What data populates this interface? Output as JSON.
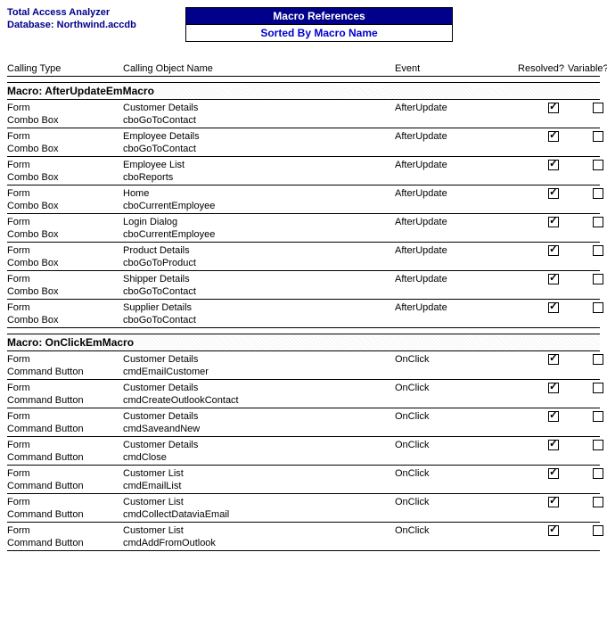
{
  "header": {
    "app_title": "Total Access Analyzer",
    "db_label": "Database: Northwind.accdb",
    "report_title": "Macro References",
    "report_subtitle": "Sorted By Macro Name"
  },
  "columns": {
    "type": "Calling Type",
    "name": "Calling Object Name",
    "event": "Event",
    "resolved": "Resolved?",
    "variable": "Variable?"
  },
  "groups": [
    {
      "title": "Macro: AfterUpdateEmMacro",
      "rows": [
        {
          "type1": "Form",
          "name1": "Customer Details",
          "event": "AfterUpdate",
          "type2": "Combo Box",
          "name2": "cboGoToContact",
          "resolved": true,
          "variable": false
        },
        {
          "type1": "Form",
          "name1": "Employee Details",
          "event": "AfterUpdate",
          "type2": "Combo Box",
          "name2": "cboGoToContact",
          "resolved": true,
          "variable": false
        },
        {
          "type1": "Form",
          "name1": "Employee List",
          "event": "AfterUpdate",
          "type2": "Combo Box",
          "name2": "cboReports",
          "resolved": true,
          "variable": false
        },
        {
          "type1": "Form",
          "name1": "Home",
          "event": "AfterUpdate",
          "type2": "Combo Box",
          "name2": "cboCurrentEmployee",
          "resolved": true,
          "variable": false
        },
        {
          "type1": "Form",
          "name1": "Login Dialog",
          "event": "AfterUpdate",
          "type2": "Combo Box",
          "name2": "cboCurrentEmployee",
          "resolved": true,
          "variable": false
        },
        {
          "type1": "Form",
          "name1": "Product Details",
          "event": "AfterUpdate",
          "type2": "Combo Box",
          "name2": "cboGoToProduct",
          "resolved": true,
          "variable": false
        },
        {
          "type1": "Form",
          "name1": "Shipper Details",
          "event": "AfterUpdate",
          "type2": "Combo Box",
          "name2": "cboGoToContact",
          "resolved": true,
          "variable": false
        },
        {
          "type1": "Form",
          "name1": "Supplier Details",
          "event": "AfterUpdate",
          "type2": "Combo Box",
          "name2": "cboGoToContact",
          "resolved": true,
          "variable": false
        }
      ]
    },
    {
      "title": "Macro: OnClickEmMacro",
      "rows": [
        {
          "type1": "Form",
          "name1": "Customer Details",
          "event": "OnClick",
          "type2": "Command Button",
          "name2": "cmdEmailCustomer",
          "resolved": true,
          "variable": false
        },
        {
          "type1": "Form",
          "name1": "Customer Details",
          "event": "OnClick",
          "type2": "Command Button",
          "name2": "cmdCreateOutlookContact",
          "resolved": true,
          "variable": false
        },
        {
          "type1": "Form",
          "name1": "Customer Details",
          "event": "OnClick",
          "type2": "Command Button",
          "name2": "cmdSaveandNew",
          "resolved": true,
          "variable": false
        },
        {
          "type1": "Form",
          "name1": "Customer Details",
          "event": "OnClick",
          "type2": "Command Button",
          "name2": "cmdClose",
          "resolved": true,
          "variable": false
        },
        {
          "type1": "Form",
          "name1": "Customer List",
          "event": "OnClick",
          "type2": "Command Button",
          "name2": "cmdEmailList",
          "resolved": true,
          "variable": false
        },
        {
          "type1": "Form",
          "name1": "Customer List",
          "event": "OnClick",
          "type2": "Command Button",
          "name2": "cmdCollectDataviaEmail",
          "resolved": true,
          "variable": false
        },
        {
          "type1": "Form",
          "name1": "Customer List",
          "event": "OnClick",
          "type2": "Command Button",
          "name2": "cmdAddFromOutlook",
          "resolved": true,
          "variable": false
        }
      ]
    }
  ]
}
